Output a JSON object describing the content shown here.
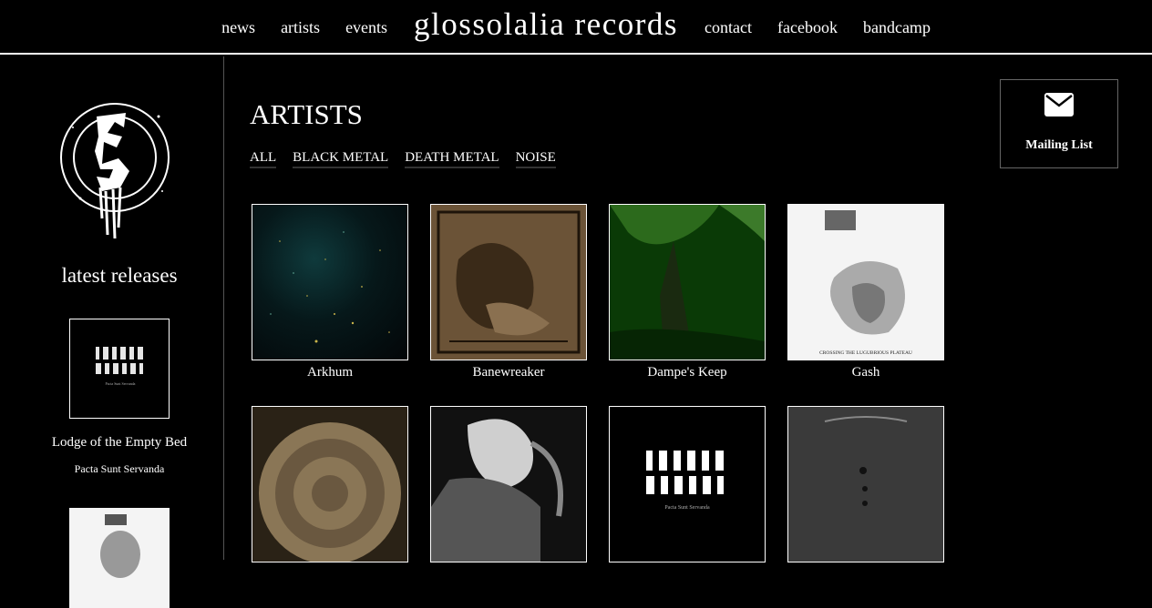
{
  "nav": {
    "left": [
      "news",
      "artists",
      "events"
    ],
    "brand": "glossolalia records",
    "right": [
      "contact",
      "facebook",
      "bandcamp"
    ]
  },
  "sidebar": {
    "logo_icon": "glossolalia-logo-icon",
    "latest_title": "latest releases",
    "releases": [
      {
        "artist": "Lodge of the Empty Bed",
        "album": "Pacta Sunt Servanda"
      },
      {
        "artist": "",
        "album": ""
      }
    ]
  },
  "main": {
    "title": "ARTISTS",
    "filters": [
      "ALL",
      "BLACK METAL",
      "DEATH METAL",
      "NOISE"
    ],
    "artists": [
      {
        "name": "Arkhum",
        "cover_color": "#0a1014"
      },
      {
        "name": "Banewreaker",
        "cover_color": "#6b5337"
      },
      {
        "name": "Dampe's Keep",
        "cover_color": "#0a3a06"
      },
      {
        "name": "Gash",
        "cover_color": "#f4f4f4"
      },
      {
        "name": "",
        "cover_color": "#6a5840"
      },
      {
        "name": "",
        "cover_color": "#1a1a1a"
      },
      {
        "name": "",
        "cover_color": "#000000"
      },
      {
        "name": "",
        "cover_color": "#3a3a3a"
      }
    ],
    "cover_texts": {
      "gash": "CROSSING THE LUGUBRIOUS PLATEAU",
      "lodge": "Pacta Sunt Servanda"
    }
  },
  "mailing": {
    "label": "Mailing List",
    "icon": "envelope-icon"
  }
}
